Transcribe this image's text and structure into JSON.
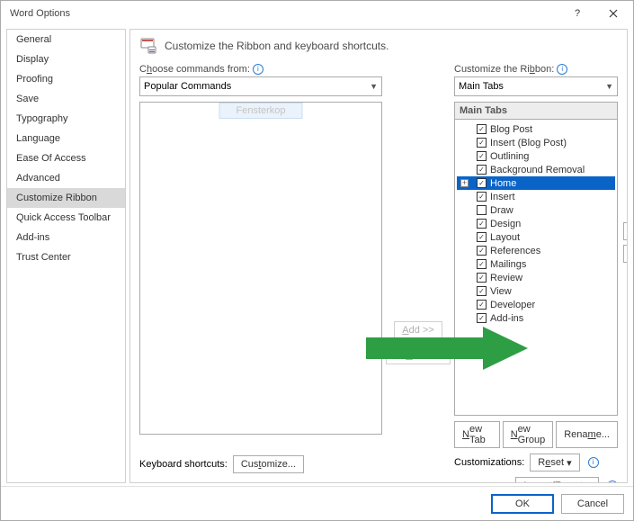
{
  "window": {
    "title": "Word Options"
  },
  "sidebar": {
    "items": [
      {
        "label": "General"
      },
      {
        "label": "Display"
      },
      {
        "label": "Proofing"
      },
      {
        "label": "Save"
      },
      {
        "label": "Typography"
      },
      {
        "label": "Language"
      },
      {
        "label": "Ease Of Access"
      },
      {
        "label": "Advanced"
      },
      {
        "label": "Customize Ribbon"
      },
      {
        "label": "Quick Access Toolbar"
      },
      {
        "label": "Add-ins"
      },
      {
        "label": "Trust Center"
      }
    ],
    "active_index": 8
  },
  "main": {
    "heading": "Customize the Ribbon and keyboard shortcuts.",
    "left_label_pre": "C",
    "left_label_u": "h",
    "left_label_post": "oose commands from:",
    "left_combo": "Popular Commands",
    "ghost_button": "Fensterkop",
    "add_btn_pre": "",
    "add_btn_u": "A",
    "add_btn_post": "dd >>",
    "remove_btn_pre": "<< ",
    "remove_btn_u": "R",
    "remove_btn_post": "emove",
    "right_label_pre": "Customize the Ri",
    "right_label_u": "b",
    "right_label_post": "bon:",
    "right_combo": "Main Tabs",
    "tabs_header": "Main Tabs",
    "tabs": [
      {
        "label": "Blog Post",
        "checked": true
      },
      {
        "label": "Insert (Blog Post)",
        "checked": true
      },
      {
        "label": "Outlining",
        "checked": true
      },
      {
        "label": "Background Removal",
        "checked": true
      },
      {
        "label": "Home",
        "checked": true,
        "selected": true,
        "expandable": true
      },
      {
        "label": "Insert",
        "checked": true
      },
      {
        "label": "Draw",
        "checked": false
      },
      {
        "label": "Design",
        "checked": true
      },
      {
        "label": "Layout",
        "checked": true
      },
      {
        "label": "References",
        "checked": true
      },
      {
        "label": "Mailings",
        "checked": true
      },
      {
        "label": "Review",
        "checked": true
      },
      {
        "label": "View",
        "checked": true
      },
      {
        "label": "Developer",
        "checked": true
      },
      {
        "label": "Add-ins",
        "checked": true
      }
    ],
    "newtab_u": "N",
    "newtab_post": "ew Tab",
    "newgroup_u": "N",
    "newgroup_post": "ew Group",
    "rename_pre": "Rena",
    "rename_u": "m",
    "rename_post": "e...",
    "customizations_label": "Customizations:",
    "reset_pre": "R",
    "reset_u": "e",
    "reset_post": "set",
    "importexport_pre": "Import/Export",
    "ks_label": "Keyboard shortcuts:",
    "ks_btn_pre": "Cus",
    "ks_btn_u": "t",
    "ks_btn_post": "omize..."
  },
  "footer": {
    "ok": "OK",
    "cancel": "Cancel"
  }
}
